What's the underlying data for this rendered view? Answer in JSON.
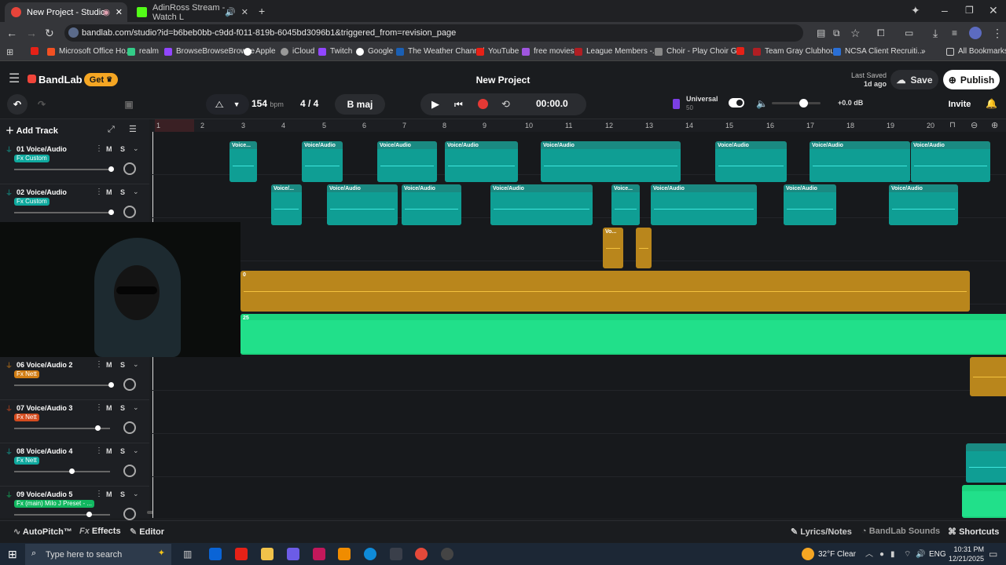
{
  "browser": {
    "tabs": [
      {
        "label": "New Project - Studio"
      },
      {
        "label": "AdinRoss Stream - Watch L"
      }
    ],
    "url": "bandlab.com/studio?id=b6beb0bb-c9dd-f011-819b-6045bd3096b1&triggered_from=revision_page",
    "bookmarks": [
      "Microsoft Office Ho...",
      "realm",
      "BrowseBrowseBrowse",
      "Apple",
      "iCloud",
      "Twitch",
      "Google",
      "The Weather Channel",
      "YouTube",
      "free movies",
      "League Members -...",
      "Choir - Play Choir G...",
      "Team Gray Clubhou...",
      "NCSA Client Recruiti..."
    ],
    "all_bookmarks": "All Bookmarks"
  },
  "app": {
    "brand": "BandLab",
    "get_label": "Get",
    "project_title": "New Project",
    "last_saved_label": "Last Saved",
    "last_saved_value": "1d ago",
    "save_label": "Save",
    "publish_label": "Publish",
    "invite_label": "Invite"
  },
  "toolbar": {
    "bpm_value": "154",
    "bpm_unit": "bpm",
    "time_sig": "4 / 4",
    "key": "B maj",
    "time": "00:00.0",
    "universal_label": "Universal",
    "universal_value": "50",
    "volume_db": "+0.0 dB"
  },
  "ruler": [
    "1",
    "2",
    "3",
    "4",
    "5",
    "6",
    "7",
    "8",
    "9",
    "10",
    "11",
    "12",
    "13",
    "14",
    "15",
    "16",
    "17",
    "18",
    "19",
    "20"
  ],
  "add_track": "Add Track",
  "tracks": [
    {
      "name": "01  Voice/Audio",
      "fx": "Fx Custom",
      "fxcolor": "#0fa99e"
    },
    {
      "name": "02  Voice/Audio",
      "fx": "Fx Custom",
      "fxcolor": "#0fa99e"
    },
    {
      "name": "06  Voice/Audio 2",
      "fx": "Fx Nett",
      "fxcolor": "#d17d14"
    },
    {
      "name": "07  Voice/Audio 3",
      "fx": "Fx Nett",
      "fxcolor": "#d44b1e"
    },
    {
      "name": "08  Voice/Audio 4",
      "fx": "Fx Nett",
      "fxcolor": "#0fa99e"
    },
    {
      "name": "09  Voice/Audio 5",
      "fx": "Fx (main) Milo J Preset - ...",
      "fxcolor": "#11b860"
    }
  ],
  "clip_label": "Voice/Audio",
  "clip_label_short1": "Voice...",
  "clip_label_short2": "Voice/...",
  "clip_label_tiny": "Vo...",
  "gold_marker": "0",
  "green_marker": "25",
  "footer": {
    "autopitch": "AutoPitch™",
    "effects": "Effects",
    "editor": "Editor",
    "lyrics": "Lyrics/Notes",
    "sounds": "BandLab Sounds",
    "shortcuts": "Shortcuts"
  },
  "taskbar": {
    "search_placeholder": "Type here to search",
    "weather": "32°F  Clear",
    "lang": "ENG",
    "time": "10:31 PM",
    "date": "12/21/2025"
  }
}
